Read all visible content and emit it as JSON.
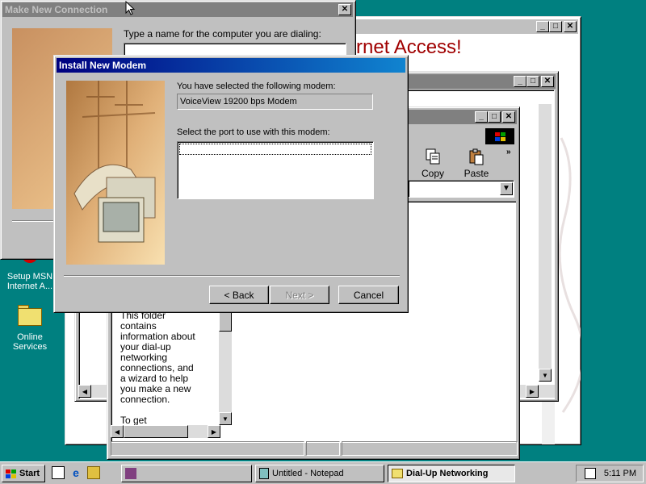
{
  "desktop": {
    "icons": [
      {
        "label_line1": "Setup MSN",
        "label_line2": "Internet A..."
      },
      {
        "label_line1": "Online",
        "label_line2": "Services"
      }
    ]
  },
  "ie_window": {
    "heading": "rnet Access!"
  },
  "explorer_window": {
    "toolbar": {
      "copy_label": "Copy",
      "paste_label": "Paste"
    },
    "info_text": [
      "This folder",
      "contains",
      "information about",
      "your dial-up",
      "networking",
      "connections, and",
      "a wizard to help",
      "you make a new",
      "connection.",
      "",
      "To get"
    ]
  },
  "make_new_connection": {
    "title": "Make New Connection",
    "prompt": "Type a name for the computer you are dialing:"
  },
  "install_modem": {
    "title": "Install New Modem",
    "selected_label": "You have selected the following modem:",
    "modem_name": "VoiceView 19200 bps Modem",
    "port_label": "Select the port to use with this modem:",
    "back_label": "< Back",
    "next_label": "Next >",
    "cancel_label": "Cancel"
  },
  "taskbar": {
    "start_label": "Start",
    "tasks": [
      {
        "label": ""
      },
      {
        "label": "Untitled - Notepad"
      },
      {
        "label": "Dial-Up Networking"
      }
    ],
    "clock": "5:11 PM"
  },
  "colors": {
    "desktop": "#008080",
    "title_active": "#000080",
    "title_inactive": "#808080",
    "ie_heading": "#a00000"
  }
}
